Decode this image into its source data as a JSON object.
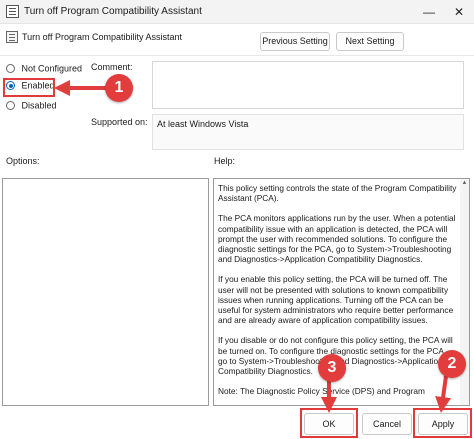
{
  "window": {
    "title": "Turn off Program Compatibility Assistant",
    "minimize_glyph": "—",
    "close_glyph": "✕"
  },
  "header": {
    "policy_name": "Turn off Program Compatibility Assistant",
    "previous_label": "Previous Setting",
    "next_label": "Next Setting"
  },
  "state": {
    "options": [
      {
        "label": "Not Configured",
        "selected": false
      },
      {
        "label": "Enabled",
        "selected": true
      },
      {
        "label": "Disabled",
        "selected": false
      }
    ]
  },
  "comment": {
    "label": "Comment:",
    "value": ""
  },
  "supported": {
    "label": "Supported on:",
    "value": "At least Windows Vista"
  },
  "panels": {
    "options_label": "Options:",
    "help_label": "Help:"
  },
  "help_text": [
    "This policy setting controls the state of the Program Compatibility Assistant (PCA).",
    "The PCA monitors applications run by the user. When a potential compatibility issue with an application is detected, the PCA will prompt the user with recommended solutions.  To configure the diagnostic settings for the PCA, go to System->Troubleshooting and Diagnostics->Application Compatibility Diagnostics.",
    "If you enable this policy setting, the PCA will be turned off. The user will not be presented with solutions to known compatibility issues when running applications. Turning off the PCA can be useful for system administrators who require better performance and are already aware of application compatibility issues.",
    "If you disable or do not configure this policy setting, the PCA will be turned on. To configure the diagnostic settings for the PCA, go to System->Troubleshooting and Diagnostics->Application Compatibility Diagnostics.",
    "Note: The Diagnostic Policy Service (DPS) and Program"
  ],
  "footer": {
    "ok_label": "OK",
    "cancel_label": "Cancel",
    "apply_label": "Apply"
  },
  "callouts": [
    "1",
    "2",
    "3"
  ],
  "colors": {
    "annotation": "#e23c3c",
    "radio_accent": "#0067c0"
  }
}
